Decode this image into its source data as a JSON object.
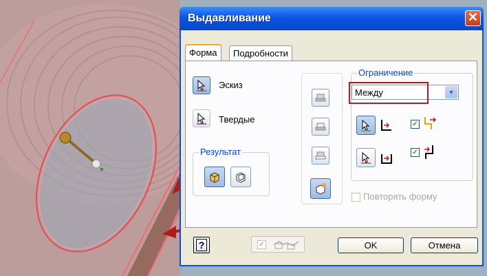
{
  "dialog": {
    "title": "Выдавливание",
    "close_glyph": "✕",
    "tabs": [
      {
        "label": "Форма",
        "active": true
      },
      {
        "label": "Подробности",
        "active": false
      }
    ],
    "profile": {
      "sketch_label": "Эскиз",
      "solids_label": "Твердые"
    },
    "result": {
      "group_label": "Результат"
    },
    "limit": {
      "group_label": "Ограничение",
      "selected": "Между",
      "from_checked": true,
      "to_checked": true
    },
    "repeat_shape_label": "Повторять форму",
    "repeat_shape_checked": false,
    "ok_label": "OK",
    "cancel_label": "Отмена",
    "help_glyph": "?",
    "preview_checked": true
  },
  "colors": {
    "title_bar": "#0a55e3",
    "dialog_bg": "#ece9d8",
    "highlight_box": "#c0161b",
    "arrow": "#b01c1c",
    "model_shaded": "#c8776e"
  }
}
